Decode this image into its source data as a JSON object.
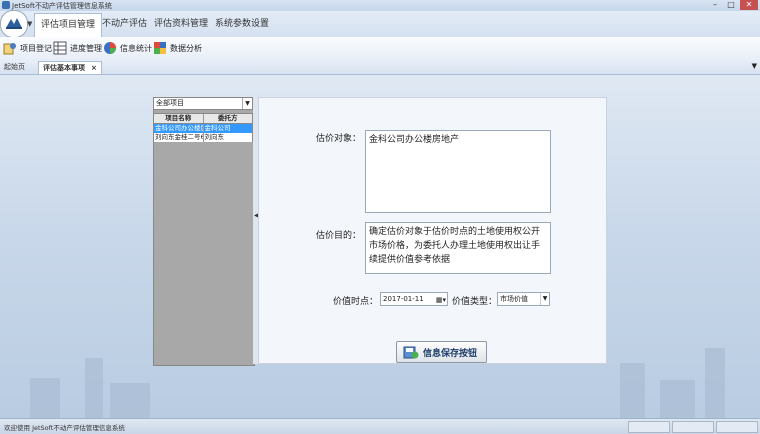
{
  "window": {
    "title": "JetSoft不动产评估管理信息系统"
  },
  "ribbon": {
    "tabs": [
      {
        "label": "评估项目管理",
        "active": true
      },
      {
        "label": "不动产评估"
      },
      {
        "label": "评估资料管理"
      },
      {
        "label": "系统参数设置"
      }
    ],
    "tools": [
      {
        "label": "项目登记",
        "icon": "project-register-icon"
      },
      {
        "label": "进度管理",
        "icon": "progress-icon"
      },
      {
        "label": "信息统计",
        "icon": "statistics-icon"
      },
      {
        "label": "数据分析",
        "icon": "analysis-icon"
      }
    ]
  },
  "doc_tabs": [
    {
      "label": "起始页"
    },
    {
      "label": "评估基本事项",
      "active": true,
      "close": "×"
    }
  ],
  "left_panel": {
    "filter_value": "全部项目",
    "columns": [
      "项目名称",
      "委托方"
    ],
    "rows": [
      {
        "name": "金科公司办公楼房地产",
        "client": "金科公司",
        "selected": true
      },
      {
        "name": "刘向东金桂二号6楼",
        "client": "刘向东"
      }
    ]
  },
  "form": {
    "object_label": "估价对象：",
    "object_value": "金科公司办公楼房地产",
    "purpose_label": "估价目的：",
    "purpose_value": "确定估价对象于估价时点的土地使用权公开市场价格，为委托人办理土地使用权出让手续提供价值参考依据",
    "date_label": "价值时点：",
    "date_value": "2017-01-11",
    "type_label": "价值类型：",
    "type_value": "市场价值",
    "save_label": "信息保存按钮"
  },
  "status": {
    "text": "欢迎使用 JetSoft不动产评估管理信息系统"
  },
  "colors": {
    "accent": "#3399ff",
    "panel_bg": "#f3f6fa",
    "list_bg": "#a8a8a8"
  }
}
